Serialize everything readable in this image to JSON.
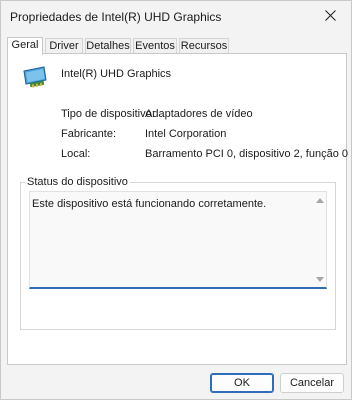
{
  "window": {
    "title": "Propriedades de Intel(R) UHD Graphics"
  },
  "tabs": [
    {
      "label": "Geral",
      "active": true
    },
    {
      "label": "Driver",
      "active": false
    },
    {
      "label": "Detalhes",
      "active": false
    },
    {
      "label": "Eventos",
      "active": false
    },
    {
      "label": "Recursos",
      "active": false
    }
  ],
  "general": {
    "device_icon": "display-adapter-icon",
    "device_name": "Intel(R) UHD Graphics",
    "properties": [
      {
        "label": "Tipo de dispositivo:",
        "value": "Adaptadores de vídeo"
      },
      {
        "label": "Fabricante:",
        "value": "Intel Corporation"
      },
      {
        "label": "Local:",
        "value": "Barramento PCI 0, dispositivo 2, função 0"
      }
    ],
    "status_group_label": "Status do dispositivo",
    "status_text": "Este dispositivo está funcionando corretamente."
  },
  "buttons": {
    "ok": "OK",
    "cancel": "Cancelar"
  },
  "colors": {
    "accent": "#2f6db8",
    "background": "#f3f3f3",
    "panel": "#ffffff"
  }
}
